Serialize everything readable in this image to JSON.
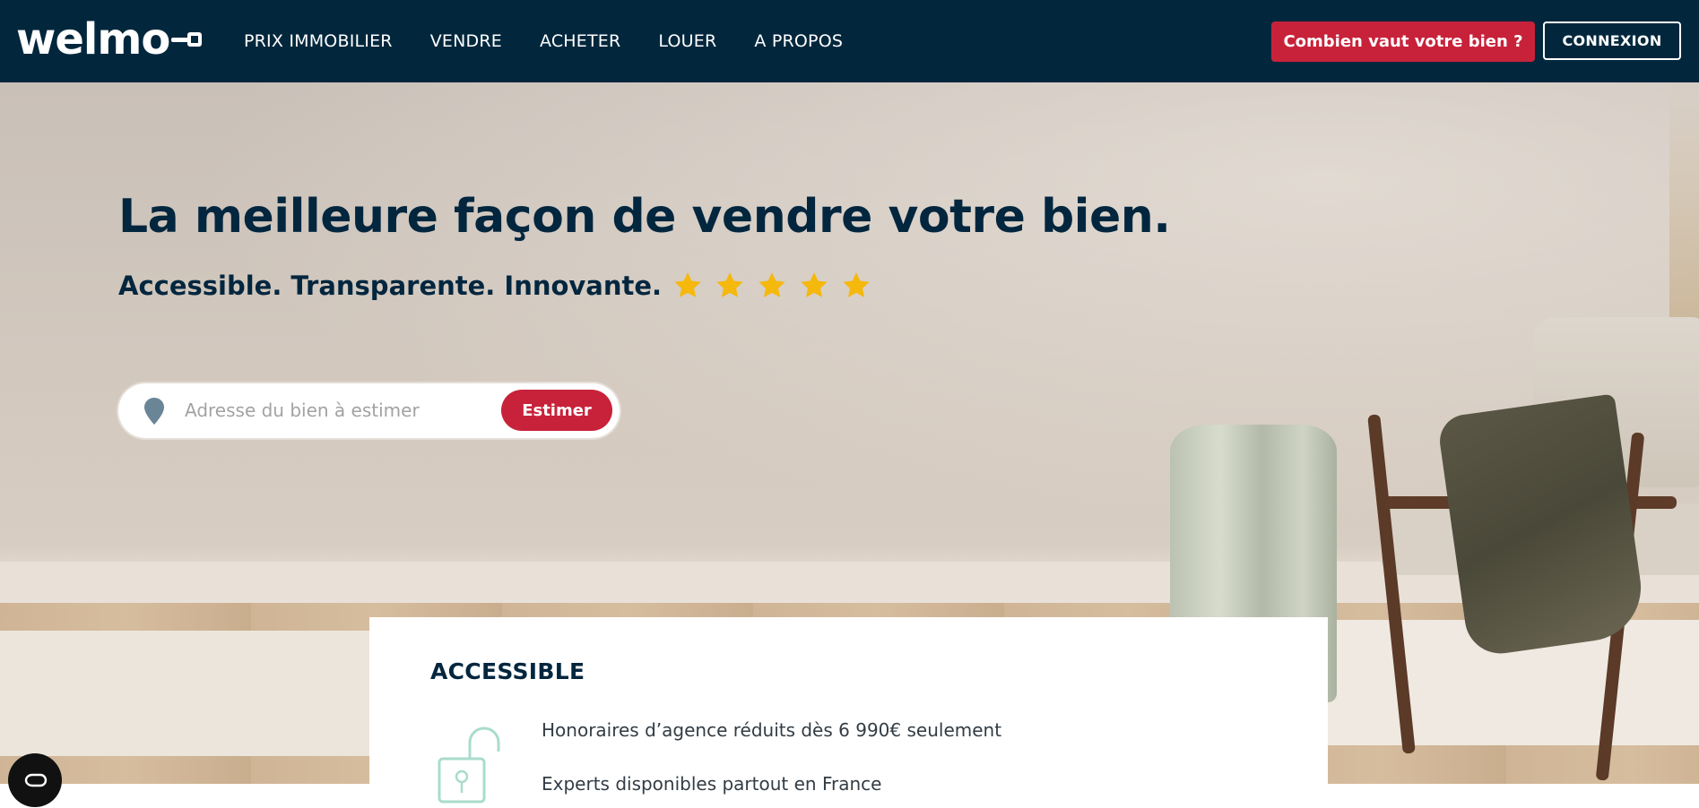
{
  "header": {
    "logo_text": "welmo",
    "nav": [
      {
        "label": "PRIX IMMOBILIER"
      },
      {
        "label": "VENDRE"
      },
      {
        "label": "ACHETER"
      },
      {
        "label": "LOUER"
      },
      {
        "label": "A PROPOS"
      }
    ],
    "cta_label": "Combien vaut votre bien ?",
    "login_label": "CONNEXION"
  },
  "hero": {
    "title": "La meilleure façon de vendre votre bien.",
    "subtitle": "Accessible. Transparente. Innovante.",
    "rating": {
      "value": 5,
      "max": 5,
      "icon": "star-icon",
      "color": "#f5b80d"
    },
    "search": {
      "placeholder": "Adresse du bien à estimer",
      "value": "",
      "button_label": "Estimer"
    }
  },
  "card": {
    "title": "ACCESSIBLE",
    "icon": "unlocked-padlock-icon",
    "features": [
      "Honoraires d’agence réduits dès 6 990€ seulement",
      "Experts disponibles partout en France"
    ]
  },
  "cookie_button": {
    "icon": "cookie-consent-icon"
  },
  "colors": {
    "navy": "#02273d",
    "accent_red": "#c8223a",
    "star_yellow": "#f5b80d",
    "white": "#ffffff"
  }
}
